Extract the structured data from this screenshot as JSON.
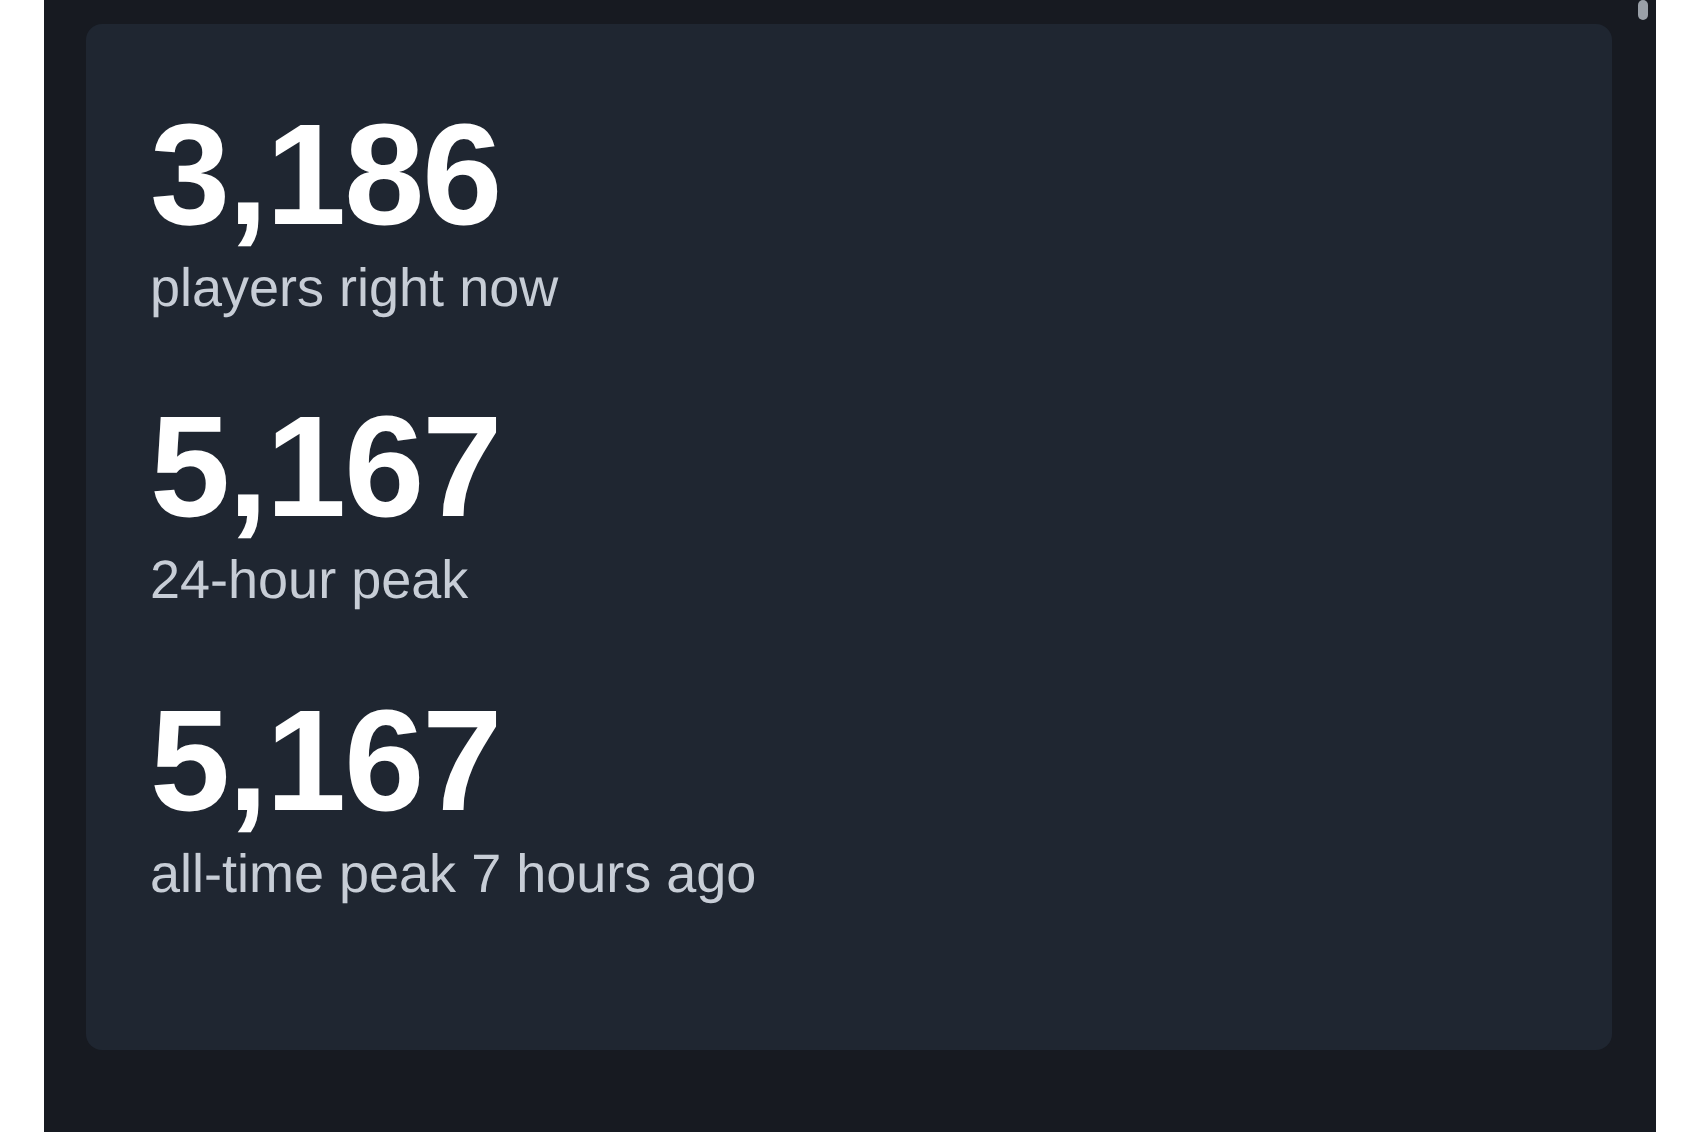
{
  "stats": [
    {
      "value": "3,186",
      "label": "players right now"
    },
    {
      "value": "5,167",
      "label": "24-hour peak"
    },
    {
      "value": "5,167",
      "label": "all-time peak 7 hours ago"
    }
  ]
}
